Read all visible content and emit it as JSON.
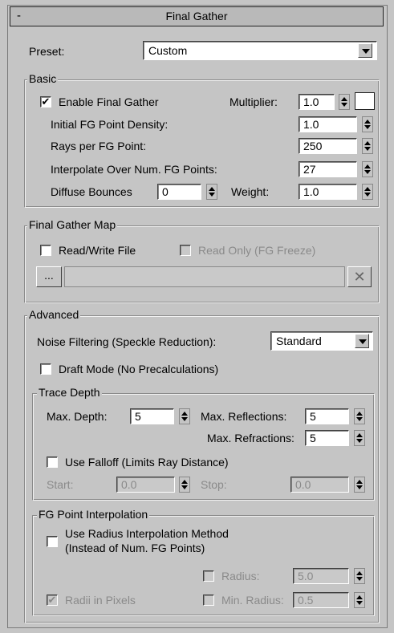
{
  "title": "Final Gather",
  "collapse_glyph": "-",
  "preset": {
    "label": "Preset:",
    "value": "Custom"
  },
  "basic": {
    "legend": "Basic",
    "enable_fg": {
      "label": "Enable Final Gather",
      "checked": true
    },
    "multiplier": {
      "label": "Multiplier:",
      "value": "1.0",
      "color": "#ffffff"
    },
    "initial_density": {
      "label": "Initial FG Point Density:",
      "value": "1.0"
    },
    "rays": {
      "label": "Rays per FG Point:",
      "value": "250"
    },
    "interpolate": {
      "label": "Interpolate Over Num. FG Points:",
      "value": "27"
    },
    "diffuse_bounces": {
      "label": "Diffuse Bounces",
      "value": "0"
    },
    "weight": {
      "label": "Weight:",
      "value": "1.0"
    }
  },
  "fg_map": {
    "legend": "Final Gather Map",
    "read_write": {
      "label": "Read/Write File",
      "checked": false
    },
    "read_only": {
      "label": "Read Only (FG Freeze)",
      "checked": false
    },
    "browse_label": "...",
    "path_value": "",
    "clear_glyph": "✕"
  },
  "advanced": {
    "legend": "Advanced",
    "noise": {
      "label": "Noise Filtering (Speckle Reduction):",
      "value": "Standard"
    },
    "draft": {
      "label": "Draft Mode (No Precalculations)",
      "checked": false
    },
    "trace": {
      "legend": "Trace Depth",
      "max_depth": {
        "label": "Max. Depth:",
        "value": "5"
      },
      "max_reflections": {
        "label": "Max. Reflections:",
        "value": "5"
      },
      "max_refractions": {
        "label": "Max. Refractions:",
        "value": "5"
      },
      "use_falloff": {
        "label": "Use Falloff (Limits Ray Distance)",
        "checked": false
      },
      "start": {
        "label": "Start:",
        "value": "0.0"
      },
      "stop": {
        "label": "Stop:",
        "value": "0.0"
      }
    },
    "interp": {
      "legend": "FG Point Interpolation",
      "use_radius_line1": "Use Radius Interpolation Method",
      "use_radius_line2": "(Instead of Num. FG Points)",
      "use_radius_checked": false,
      "radius": {
        "label": "Radius:",
        "value": "5.0",
        "checked": false
      },
      "radii_pixels": {
        "label": "Radii in Pixels",
        "checked": true
      },
      "min_radius": {
        "label": "Min. Radius:",
        "value": "0.5",
        "checked": false
      }
    }
  },
  "check_glyph": "✔"
}
